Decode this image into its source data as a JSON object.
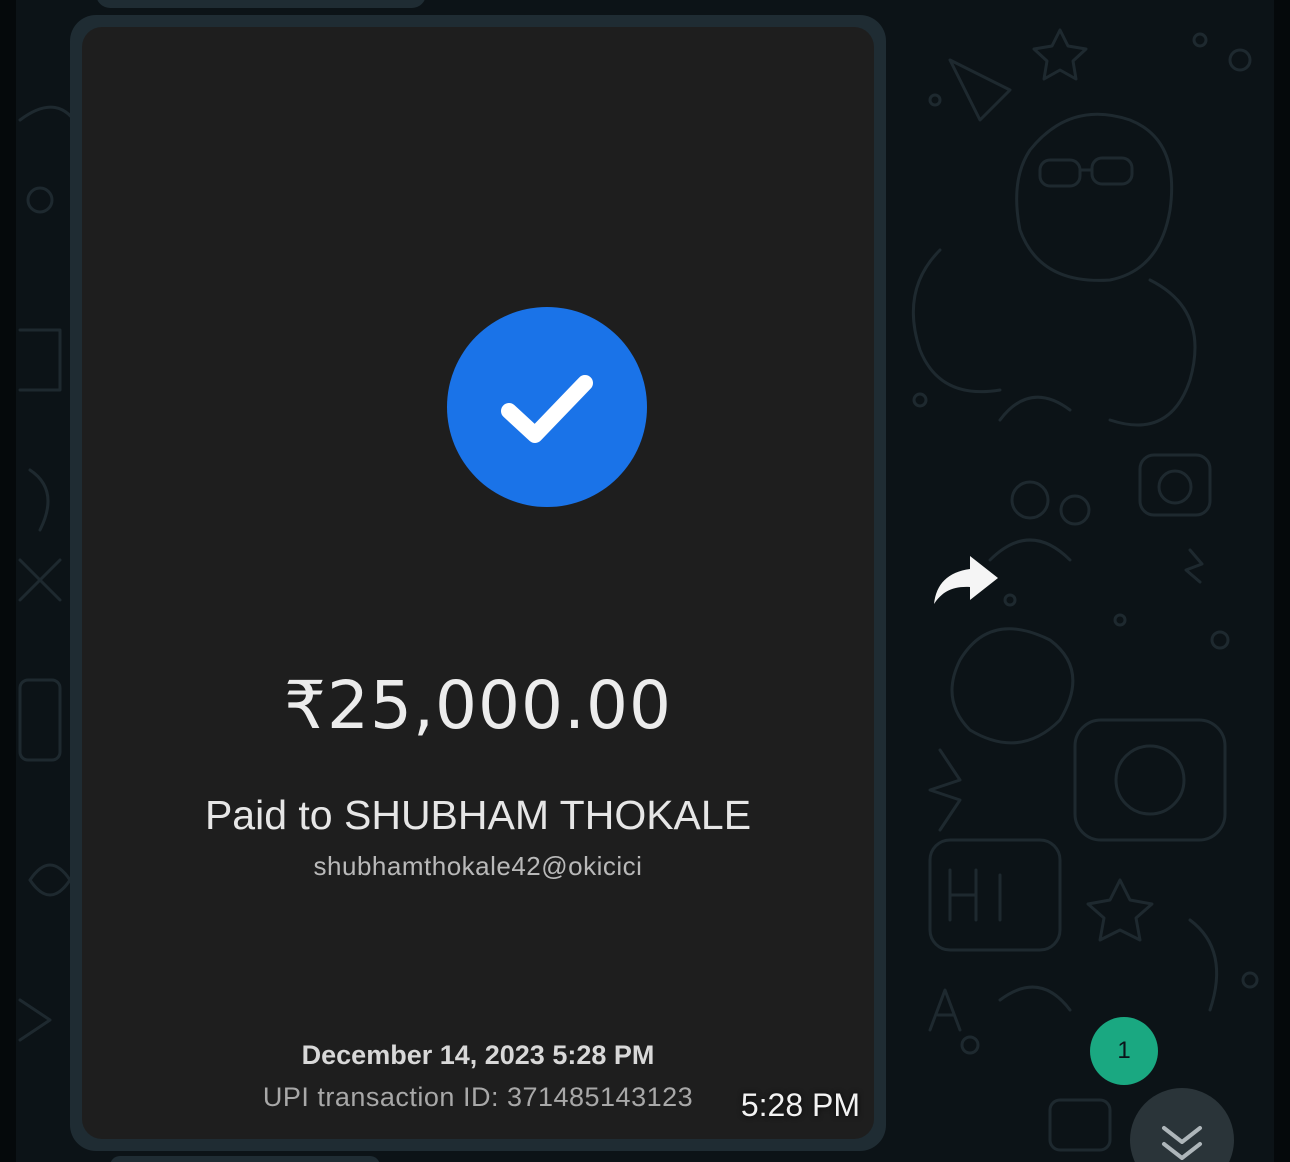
{
  "receipt": {
    "amount": "₹25,000.00",
    "paid_to": "Paid to SHUBHAM THOKALE",
    "upi_id": "shubhamthokale42@okicici",
    "date": "December 14, 2023 5:28 PM",
    "transaction_id": "UPI transaction ID: 371485143123"
  },
  "message": {
    "timestamp": "5:28 PM"
  },
  "scroll": {
    "unread_count": "1"
  },
  "icons": {
    "status": "check-circle-icon",
    "forward": "forward-arrow-icon",
    "scroll": "double-chevron-down-icon"
  },
  "colors": {
    "chat_background": "#0c1317",
    "bubble": "#1f2c33",
    "receipt_background": "#1e1e1e",
    "check_blue": "#1a73e8",
    "badge_green": "#1aa881"
  }
}
